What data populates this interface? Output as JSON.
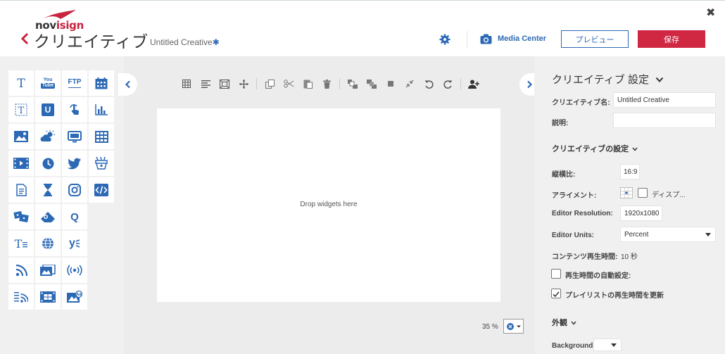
{
  "header": {
    "logo": {
      "part1": "nov",
      "part2": "isign"
    },
    "title": "クリエイティブ",
    "creative_name": "Untitled Creative",
    "unsaved_marker": "✱",
    "media_center": "Media Center",
    "preview_label": "プレビュー",
    "save_label": "保存",
    "close_icon": "✖"
  },
  "widgets": {
    "rows": [
      [
        "text",
        "youtube",
        "ftp",
        "calendar"
      ],
      [
        "text-box",
        "uniform",
        "touch",
        "bar-chart"
      ],
      [
        "image",
        "weather",
        "screen",
        "table"
      ],
      [
        "video",
        "clock",
        "twitter",
        "game"
      ],
      [
        "document",
        "hourglass",
        "instagram",
        "html"
      ],
      [
        "cards",
        "shapes",
        "query",
        ""
      ],
      [
        "text-list",
        "globe",
        "yammer",
        ""
      ],
      [
        "rss",
        "image-slideshow",
        "broadcast",
        ""
      ],
      [
        "rss-feed",
        "film-grid",
        "ad-image",
        ""
      ]
    ],
    "labels": {
      "youtube_top": "You",
      "youtube_bottom": "Tube",
      "ftp": "FTP",
      "uniform": "U",
      "query": "Q",
      "yammer": "y"
    }
  },
  "canvas": {
    "drop_hint": "Drop widgets here",
    "zoom": "35 %",
    "toolbar_icons": [
      "grid-icon",
      "align-icon",
      "fit-icon",
      "move-icon",
      "copy-icon",
      "cut-icon",
      "paste-icon",
      "delete-icon",
      "bring-front-icon",
      "send-back-icon",
      "center-icon",
      "shrink-icon",
      "undo-icon",
      "redo-icon",
      "add-user-icon"
    ]
  },
  "settings": {
    "title": "クリエイティブ 設定",
    "name_label": "クリエイティブ名:",
    "name_value": "Untitled Creative",
    "description_label": "説明:",
    "description_value": "",
    "section_creative": "クリエイティブの設定",
    "aspect_label": "縦横比:",
    "aspect_value": "16:9",
    "alignment_label": "アライメント:",
    "alignment_display": "ディスプ...",
    "editor_resolution_label": "Editor Resolution:",
    "editor_resolution_value": "1920x1080",
    "editor_units_label": "Editor Units:",
    "editor_units_value": "Percent",
    "duration_label": "コンテンツ再生時間:",
    "duration_value": "10 秒",
    "auto_duration_label": "再生時間の自動設定:",
    "auto_duration_checked": false,
    "update_playlist_label": "プレイリストの再生時間を更新",
    "update_playlist_checked": true,
    "section_appearance": "外観",
    "background_label": "Background"
  },
  "colors": {
    "accent": "#2c69b5",
    "save": "#d02743",
    "logo_swoosh": "#c8233f"
  }
}
